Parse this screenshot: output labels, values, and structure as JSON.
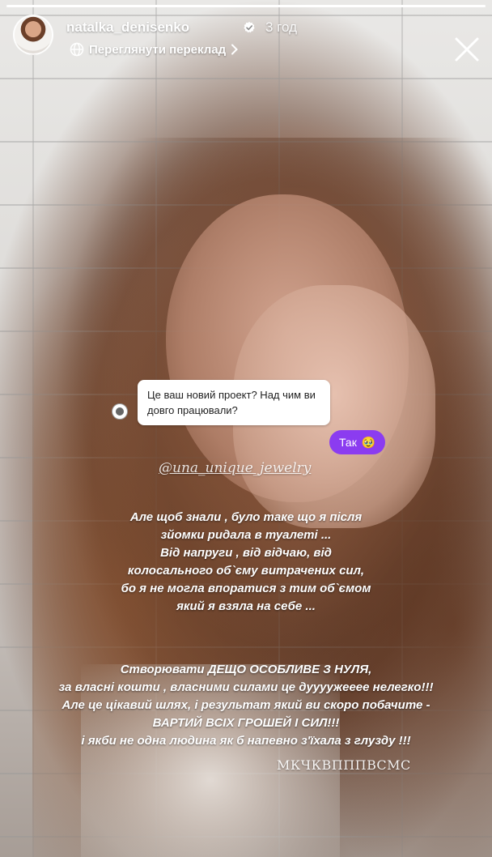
{
  "story": {
    "progress": 1.0
  },
  "header": {
    "username": "natalka_denisenko",
    "time": "3 год",
    "translate_label": "Переглянути переклад",
    "verified_icon": "verified-badge-icon",
    "close_icon": "close-icon"
  },
  "question_sticker": {
    "text": "Це ваш новий проект? Над чим ви довго працювали?"
  },
  "answer_bubble": {
    "text": "Так",
    "emoji": "🥹"
  },
  "mention": {
    "text": "@una_unique_jewelry"
  },
  "caption_block_1": {
    "lines": [
      "Але щоб знали , було таке що я після",
      "зйомки ридала в туалеті ...",
      "Від напруги , від відчаю, від",
      "колосального об`єму витрачених сил,",
      "бо я не могла впоратися з тим об`ємом",
      "який я взяла на себе ..."
    ]
  },
  "caption_block_2": {
    "lines": [
      "Створювати ДЕЩО ОСОБЛИВЕ З НУЛЯ,",
      "за власні кошти , власними силами це дуууужееее нелегко!!!",
      "Але це цікавий шлях, і результат який ви скоро побачите -",
      "ВАРТИЙ ВСІХ ГРОШЕЙ І СИЛ!!!",
      "і якби не одна людина як б напевно з'їхала з глузду !!!"
    ]
  },
  "signature": {
    "text": "МКЧКВПППВСМС"
  },
  "colors": {
    "answer_bubble": "#8b3cf0",
    "text": "#ffffff"
  }
}
